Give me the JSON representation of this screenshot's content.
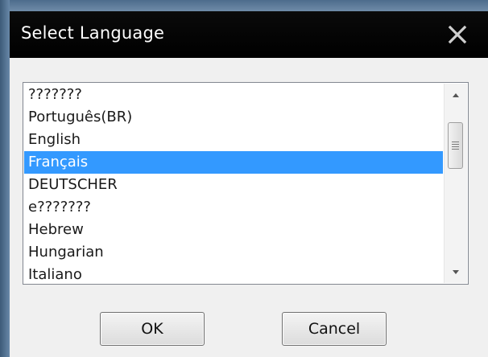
{
  "window": {
    "title": "Select Language",
    "close_icon": "close-icon"
  },
  "language_list": {
    "selected_index": 3,
    "items": [
      {
        "label": "???????"
      },
      {
        "label": "Português(BR)"
      },
      {
        "label": "English"
      },
      {
        "label": "Français"
      },
      {
        "label": "DEUTSCHER"
      },
      {
        "label": "e???????"
      },
      {
        "label": "Hebrew"
      },
      {
        "label": "Hungarian"
      },
      {
        "label": "Italiano"
      }
    ]
  },
  "buttons": {
    "ok_label": "OK",
    "cancel_label": "Cancel"
  },
  "colors": {
    "titlebar": "#000000",
    "selection": "#3399ff"
  }
}
